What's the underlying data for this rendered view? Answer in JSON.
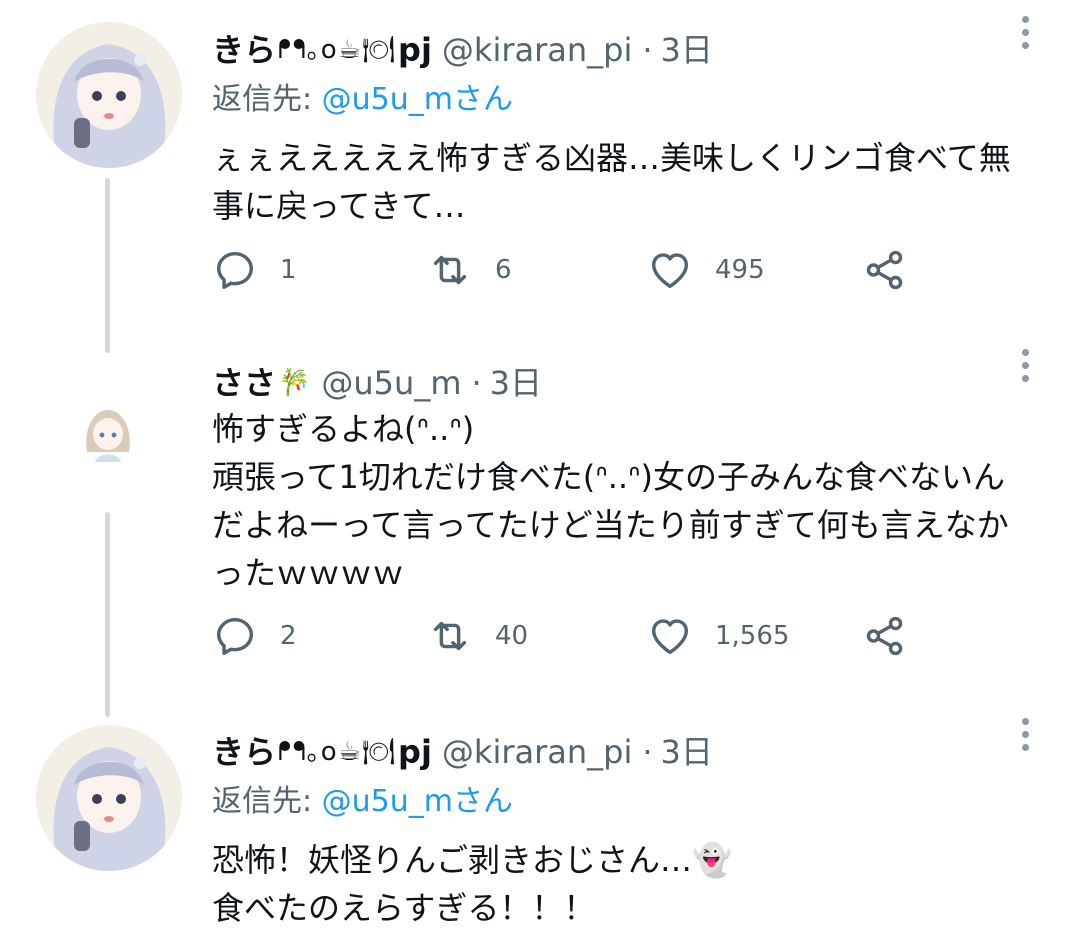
{
  "tweets": [
    {
      "name": "きら",
      "emoji": "ᖰᖳ｡o☕🍽",
      "emoji_tail": "pj",
      "handle": "@kiraran_pi",
      "separator": "·",
      "time": "3日",
      "reply_prefix": "返信先:",
      "reply_mention": "@u5u_mさん",
      "lines": [
        "ぇぇえええええ怖すぎる凶器…美味しくリンゴ食べて無",
        "事に戻ってきて…"
      ],
      "reply_count": "1",
      "retweet_count": "6",
      "like_count": "495"
    },
    {
      "name": "ささ",
      "emoji": "🎋",
      "emoji_tail": "",
      "handle": "@u5u_m",
      "separator": "·",
      "time": "3日",
      "lines": [
        "怖すぎるよね(ᐢ..ᐢ)",
        "頑張って1切れだけ食べた(ᐢ..ᐢ)女の子みんな食べないん",
        "だよねーって言ってたけど当たり前すぎて何も言えなか",
        "ったｗｗｗｗ"
      ],
      "reply_count": "2",
      "retweet_count": "40",
      "like_count": "1,565"
    },
    {
      "name": "きら",
      "emoji": "ᖰᖳ｡o☕🍽",
      "emoji_tail": "pj",
      "handle": "@kiraran_pi",
      "separator": "·",
      "time": "3日",
      "reply_prefix": "返信先:",
      "reply_mention": "@u5u_mさん",
      "lines": [
        "恐怖！妖怪りんご剥きおじさん…👻",
        "食べたのえらすぎる！！！"
      ]
    }
  ],
  "icons": {
    "reply": "reply-icon",
    "retweet": "retweet-icon",
    "like": "like-icon",
    "share": "share-icon",
    "more": "more-icon"
  },
  "colors": {
    "text": "#0f1419",
    "secondary": "#536471",
    "mention": "#1d9bf0",
    "thread_line": "#cfd9de"
  }
}
